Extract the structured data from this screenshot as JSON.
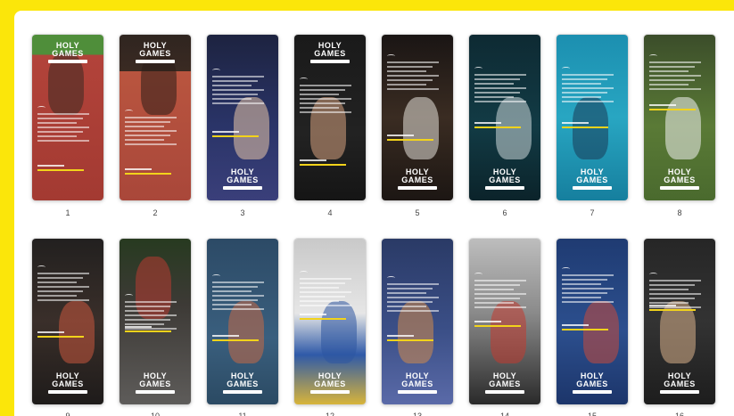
{
  "logo": {
    "line1": "HOLY",
    "line2": "GAMES"
  },
  "palette": {
    "frame": "#fbe60a",
    "panel": "#ffffff",
    "caption": "#f2d31b"
  },
  "slides": [
    {
      "number": "1",
      "theme": "running-track"
    },
    {
      "number": "2",
      "theme": "track-start"
    },
    {
      "number": "3",
      "theme": "gymnast"
    },
    {
      "number": "4",
      "theme": "gymnast-hands"
    },
    {
      "number": "5",
      "theme": "fencing"
    },
    {
      "number": "6",
      "theme": "swimmer-dark"
    },
    {
      "number": "7",
      "theme": "swimming-pool"
    },
    {
      "number": "8",
      "theme": "football"
    },
    {
      "number": "9",
      "theme": "boxing"
    },
    {
      "number": "10",
      "theme": "cycling"
    },
    {
      "number": "11",
      "theme": "rugby"
    },
    {
      "number": "12",
      "theme": "judo"
    },
    {
      "number": "13",
      "theme": "basketball"
    },
    {
      "number": "14",
      "theme": "archery"
    },
    {
      "number": "15",
      "theme": "handball"
    },
    {
      "number": "16",
      "theme": "weightlifting"
    }
  ]
}
